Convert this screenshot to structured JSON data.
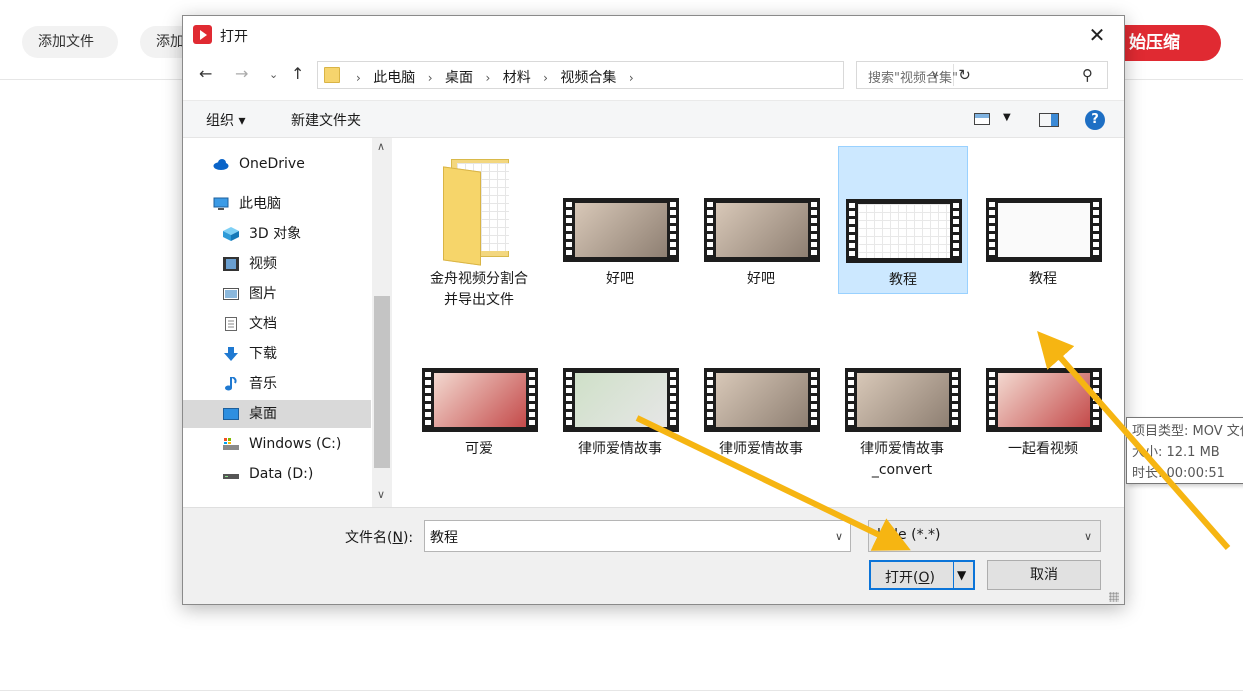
{
  "app": {
    "add_file_1": "添加文件",
    "add_file_2": "添加",
    "start_compress": "始压缩"
  },
  "dialog": {
    "title": "打开",
    "breadcrumbs": [
      "此电脑",
      "桌面",
      "材料",
      "视频合集"
    ],
    "search_placeholder": "搜索\"视频合集\"",
    "toolbar": {
      "organize": "组织 ▾",
      "new_folder": "新建文件夹"
    },
    "nav": {
      "items": [
        {
          "label": "OneDrive",
          "icon": "cloud-icon"
        },
        {
          "label": "此电脑",
          "icon": "computer-icon"
        },
        {
          "label": "3D 对象",
          "icon": "cube-icon"
        },
        {
          "label": "视频",
          "icon": "video-icon"
        },
        {
          "label": "图片",
          "icon": "picture-icon"
        },
        {
          "label": "文档",
          "icon": "document-icon"
        },
        {
          "label": "下载",
          "icon": "download-icon"
        },
        {
          "label": "音乐",
          "icon": "music-icon"
        },
        {
          "label": "桌面",
          "icon": "desktop-icon",
          "selected": true
        },
        {
          "label": "Windows (C:)",
          "icon": "drive-c-icon"
        },
        {
          "label": "Data (D:)",
          "icon": "drive-d-icon"
        }
      ]
    },
    "files": [
      {
        "label": "金舟视频分割合\n并导出文件",
        "type": "folder"
      },
      {
        "label": "好吧",
        "type": "video"
      },
      {
        "label": "好吧",
        "type": "video"
      },
      {
        "label": "教程",
        "type": "video",
        "selected": true
      },
      {
        "label": "教程",
        "type": "video"
      },
      {
        "label": "可爱",
        "type": "video"
      },
      {
        "label": "律师爱情故事",
        "type": "video"
      },
      {
        "label": "律师爱情故事",
        "type": "video"
      },
      {
        "label": "律师爱情故事\n_convert",
        "type": "video"
      },
      {
        "label": "一起看视频",
        "type": "video"
      }
    ],
    "tooltip": {
      "type": "项目类型: MOV 文件",
      "size": "大小: 12.1 MB",
      "duration": "时长: 00:00:51"
    },
    "bottom": {
      "filename_label_pre": "文件名(",
      "filename_label_key": "N",
      "filename_label_post": "):",
      "filename_value": "教程",
      "filetype_value": "l file (*.*)",
      "open_label_pre": "打开(",
      "open_label_key": "O",
      "open_label_post": ")",
      "cancel_label": "取消"
    }
  },
  "colors": {
    "accent": "#e02a32",
    "selection": "#cce8ff",
    "annotation_arrow": "#f6b512"
  }
}
